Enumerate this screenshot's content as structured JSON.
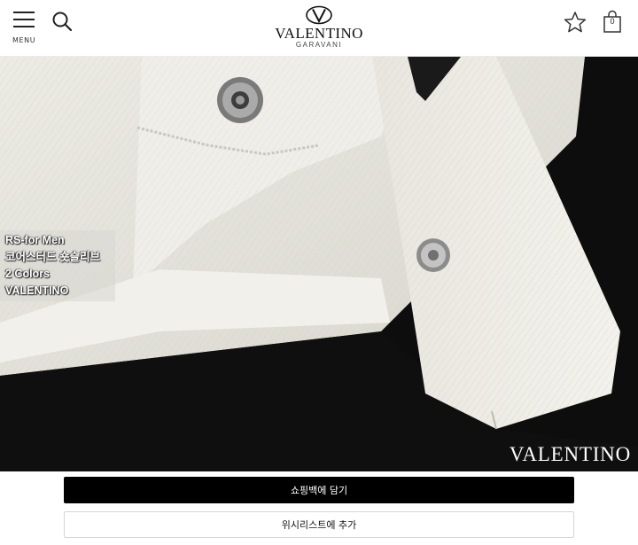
{
  "header": {
    "menu_label": "MENU",
    "logo": {
      "wordmark": "VALENTINO",
      "subline": "GARAVANI"
    },
    "bag_count": "0",
    "icons": [
      "menu-icon",
      "search-icon",
      "star-icon",
      "shopping-bag-icon"
    ]
  },
  "product": {
    "overlay_lines": [
      "RS-for Men",
      "코어스터드 숏슬리브",
      "2 Colors",
      "VALENTINO"
    ],
    "watermark": "VALENTINO"
  },
  "actions": {
    "add_to_bag": "쇼핑백에 담기",
    "add_to_wishlist": "위시리스트에 추가"
  },
  "colors": {
    "primary_button": "#000000",
    "accent": "#ffffff"
  }
}
